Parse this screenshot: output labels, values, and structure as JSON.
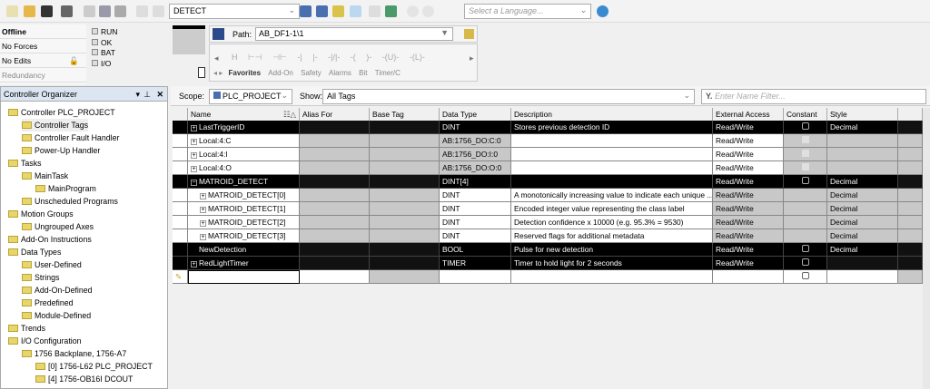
{
  "toolbar": {
    "routine_combo": "DETECT",
    "language_placeholder": "Select a Language..."
  },
  "status": {
    "mode": "Offline",
    "forces": "No Forces",
    "edits": "No Edits",
    "redundancy": "Redundancy",
    "leds": [
      "RUN",
      "OK",
      "BAT",
      "I/O"
    ]
  },
  "path": {
    "label": "Path:",
    "value": "AB_DF1-1\\1"
  },
  "instruction_tabs": [
    "Favorites",
    "Add-On",
    "Safety",
    "Alarms",
    "Bit",
    "Timer/C"
  ],
  "instruction_icons": [
    "H",
    "⊢⊣",
    "⊣⊢",
    "-| |-",
    "-|/|-",
    "-( )-",
    "-(U)-",
    "-(L)-"
  ],
  "organizer": {
    "title": "Controller Organizer",
    "items": [
      {
        "label": "Controller PLC_PROJECT",
        "level": 0
      },
      {
        "label": "Controller Tags",
        "level": 1
      },
      {
        "label": "Controller Fault Handler",
        "level": 1
      },
      {
        "label": "Power-Up Handler",
        "level": 1
      },
      {
        "label": "Tasks",
        "level": 0
      },
      {
        "label": "MainTask",
        "level": 1
      },
      {
        "label": "MainProgram",
        "level": 2
      },
      {
        "label": "Unscheduled Programs",
        "level": 1
      },
      {
        "label": "Motion Groups",
        "level": 0
      },
      {
        "label": "Ungrouped Axes",
        "level": 1
      },
      {
        "label": "Add-On Instructions",
        "level": 0
      },
      {
        "label": "Data Types",
        "level": 0
      },
      {
        "label": "User-Defined",
        "level": 1
      },
      {
        "label": "Strings",
        "level": 1
      },
      {
        "label": "Add-On-Defined",
        "level": 1
      },
      {
        "label": "Predefined",
        "level": 1
      },
      {
        "label": "Module-Defined",
        "level": 1
      },
      {
        "label": "Trends",
        "level": 0
      },
      {
        "label": "I/O Configuration",
        "level": 0
      },
      {
        "label": "1756 Backplane, 1756-A7",
        "level": 1
      },
      {
        "label": "[0] 1756-L62 PLC_PROJECT",
        "level": 2
      },
      {
        "label": "[4] 1756-OB16I DCOUT",
        "level": 2
      }
    ]
  },
  "scope": {
    "label": "Scope:",
    "value": "PLC_PROJECT",
    "show_label": "Show:",
    "show_value": "All Tags",
    "filter_placeholder": "Enter Name Filter..."
  },
  "table": {
    "columns": [
      "Name",
      "Alias For",
      "Base Tag",
      "Data Type",
      "Description",
      "External Access",
      "Constant",
      "Style"
    ],
    "rows": [
      {
        "name": "LastTriggerID",
        "exp": "+",
        "type": "DINT",
        "desc": "Stores previous detection ID",
        "access": "Read/Write",
        "style": "Decimal",
        "sel": true
      },
      {
        "name": "Local:4:C",
        "exp": "+",
        "type": "AB:1756_DO:C:0",
        "desc": "",
        "access": "Read/Write",
        "style": "",
        "sel": false
      },
      {
        "name": "Local:4:I",
        "exp": "+",
        "type": "AB:1756_DO:I:0",
        "desc": "",
        "access": "Read/Write",
        "style": "",
        "sel": false
      },
      {
        "name": "Local:4:O",
        "exp": "+",
        "type": "AB:1756_DO:O:0",
        "desc": "",
        "access": "Read/Write",
        "style": "",
        "sel": false
      },
      {
        "name": "MATROID_DETECT",
        "exp": "−",
        "type": "DINT[4]",
        "desc": "",
        "access": "Read/Write",
        "style": "Decimal",
        "sel": true
      },
      {
        "name": "MATROID_DETECT[0]",
        "exp": "+",
        "type": "DINT",
        "desc": "A monotonically increasing value to indicate each unique ...",
        "access": "Read/Write",
        "style": "Decimal",
        "sel": false
      },
      {
        "name": "MATROID_DETECT[1]",
        "exp": "+",
        "type": "DINT",
        "desc": "Encoded integer value representing the class label",
        "access": "Read/Write",
        "style": "Decimal",
        "sel": false
      },
      {
        "name": "MATROID_DETECT[2]",
        "exp": "+",
        "type": "DINT",
        "desc": "Detection confidence x 10000 (e.g. 95.3% = 9530)",
        "access": "Read/Write",
        "style": "Decimal",
        "sel": false
      },
      {
        "name": "MATROID_DETECT[3]",
        "exp": "+",
        "type": "DINT",
        "desc": "Reserved flags for additional metadata",
        "access": "Read/Write",
        "style": "Decimal",
        "sel": false
      },
      {
        "name": "NewDetection",
        "exp": "",
        "type": "BOOL",
        "desc": "Pulse for new detection",
        "access": "Read/Write",
        "style": "Decimal",
        "sel": true
      },
      {
        "name": "RedLightTimer",
        "exp": "+",
        "type": "TIMER",
        "desc": "Timer to hold light for 2 seconds",
        "access": "Read/Write",
        "style": "",
        "sel": true
      }
    ]
  }
}
